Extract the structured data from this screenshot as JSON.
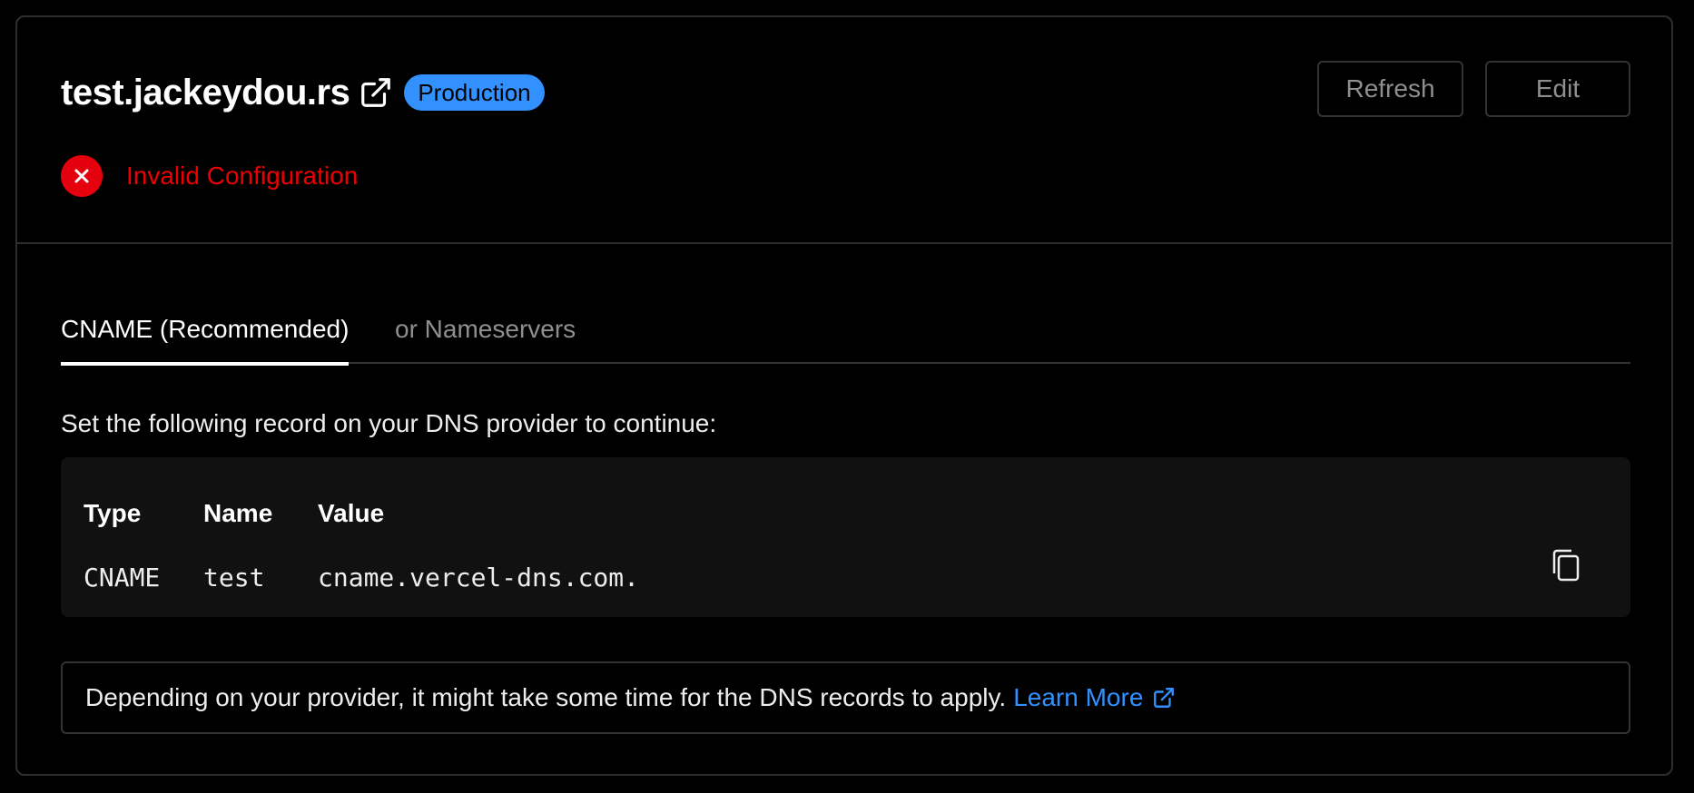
{
  "domain": {
    "name": "test.jackeydou.rs",
    "badge": "Production",
    "badge_color": "#3291ff"
  },
  "actions": {
    "refresh_label": "Refresh",
    "edit_label": "Edit"
  },
  "status": {
    "text": "Invalid Configuration",
    "color": "#ee0000",
    "icon": "x-circle-icon"
  },
  "tabs": [
    {
      "label": "CNAME (Recommended)",
      "active": true
    },
    {
      "label": "or Nameservers",
      "active": false
    }
  ],
  "instructions": "Set the following record on your DNS provider to continue:",
  "record": {
    "headers": [
      "Type",
      "Name",
      "Value"
    ],
    "values": [
      "CNAME",
      "test",
      "cname.vercel-dns.com."
    ],
    "copy_icon": "copy-icon"
  },
  "note": {
    "text": "Depending on your provider, it might take some time for the DNS records to apply.",
    "link_label": "Learn More"
  }
}
